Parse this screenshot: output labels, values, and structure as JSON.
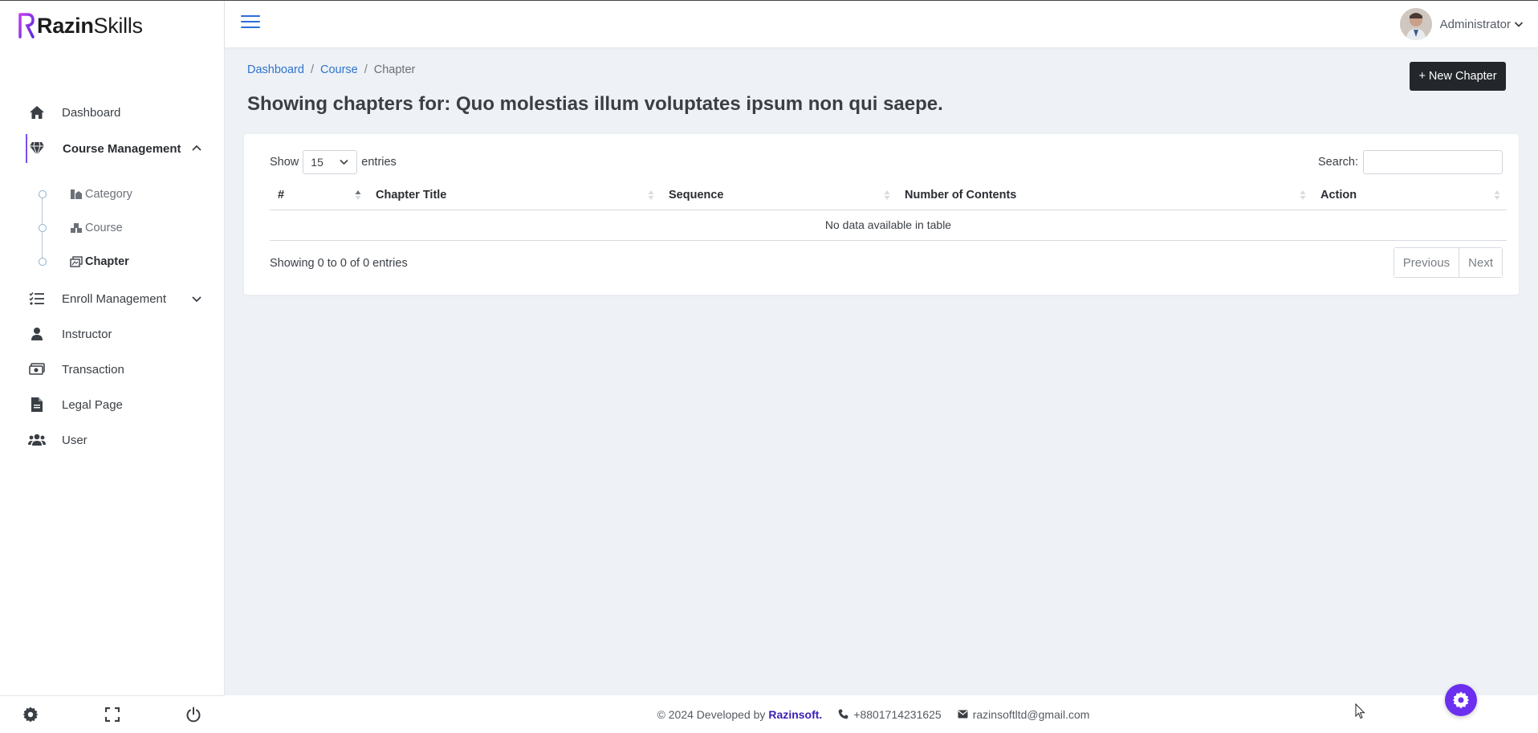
{
  "brand": {
    "part1": "Razin",
    "part2": "Skills"
  },
  "sidebar": {
    "items": [
      {
        "label": "Dashboard",
        "icon": "home-icon"
      },
      {
        "label": "Course Management",
        "icon": "gem-icon"
      },
      {
        "label": "Enroll Management",
        "icon": "list-check-icon"
      },
      {
        "label": "Instructor",
        "icon": "user-icon"
      },
      {
        "label": "Transaction",
        "icon": "money-icon"
      },
      {
        "label": "Legal Page",
        "icon": "file-icon"
      },
      {
        "label": "User",
        "icon": "users-icon"
      }
    ],
    "sub_items": [
      {
        "label": "Category"
      },
      {
        "label": "Course"
      },
      {
        "label": "Chapter"
      }
    ]
  },
  "header": {
    "user_name": "Administrator"
  },
  "breadcrumb": {
    "items": [
      "Dashboard",
      "Course",
      "Chapter"
    ],
    "separator": "/"
  },
  "page": {
    "title": "Showing chapters for: Quo molestias illum voluptates ipsum non qui saepe.",
    "new_button": "+ New Chapter"
  },
  "table": {
    "show_label": "Show",
    "entries_value": "15",
    "entries_label": "entries",
    "search_label": "Search:",
    "search_value": "",
    "columns": [
      "#",
      "Chapter Title",
      "Sequence",
      "Number of Contents",
      "Action"
    ],
    "empty_message": "No data available in table",
    "info": "Showing 0 to 0 of 0 entries",
    "prev_label": "Previous",
    "next_label": "Next"
  },
  "footer": {
    "copyright": "© 2024 Developed by",
    "developer": "Razinsoft.",
    "phone": "+8801714231625",
    "email": "razinsoftltd@gmail.com"
  },
  "colors": {
    "accent": "#6b2ff0",
    "link": "#2e73d0",
    "dark_button": "#23272b",
    "brand_text": "#3b1fb5"
  }
}
